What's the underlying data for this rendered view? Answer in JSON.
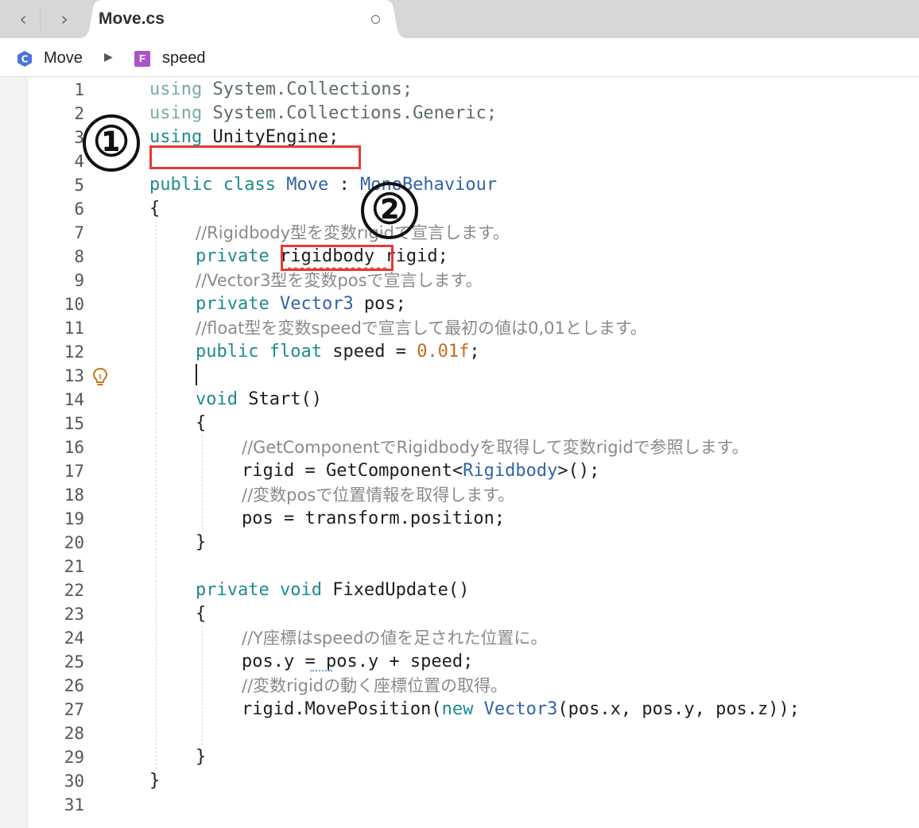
{
  "tab": {
    "title": "Move.cs",
    "back_icon": "chevron-left-icon",
    "forward_icon": "chevron-right-icon",
    "dirty_icon": "circle-icon"
  },
  "breadcrumb": {
    "class_badge": "C",
    "class_name": "Move",
    "field_badge": "F",
    "field_name": "speed"
  },
  "markers": {
    "one": "①",
    "two": "②"
  },
  "colors": {
    "keyword": "#1c8c8c",
    "type": "#3363a5",
    "number": "#c46a1c",
    "comment": "#8a8a8a",
    "annotation": "#e53935"
  },
  "editor": {
    "lines": [
      {
        "n": "1",
        "indent": 0,
        "tokens": [
          {
            "t": "using",
            "c": "kwl"
          },
          {
            "t": " System.Collections;",
            "c": "plain-light"
          }
        ]
      },
      {
        "n": "2",
        "indent": 0,
        "tokens": [
          {
            "t": "using",
            "c": "kwl"
          },
          {
            "t": " System.Collections.Generic;",
            "c": "plain-light"
          }
        ]
      },
      {
        "n": "3",
        "indent": 0,
        "tokens": [
          {
            "t": "using",
            "c": "kw"
          },
          {
            "t": " UnityEngine;",
            "c": "plain"
          }
        ]
      },
      {
        "n": "4",
        "indent": 0,
        "tokens": []
      },
      {
        "n": "5",
        "indent": 0,
        "tokens": [
          {
            "t": "public",
            "c": "kw"
          },
          {
            "t": " ",
            "c": "plain"
          },
          {
            "t": "class",
            "c": "kw"
          },
          {
            "t": " ",
            "c": "plain"
          },
          {
            "t": "Move",
            "c": "typ"
          },
          {
            "t": " : ",
            "c": "plain"
          },
          {
            "t": "MonoBehaviour",
            "c": "typ"
          }
        ]
      },
      {
        "n": "6",
        "indent": 0,
        "tokens": [
          {
            "t": "{",
            "c": "plain"
          }
        ]
      },
      {
        "n": "7",
        "indent": 1,
        "tokens": [
          {
            "t": "//Rigidbody型を変数rigidで宣言します。",
            "c": "cmt"
          }
        ]
      },
      {
        "n": "8",
        "indent": 1,
        "tokens": [
          {
            "t": "private",
            "c": "kw"
          },
          {
            "t": " rigidbody rigid;",
            "c": "plain"
          }
        ]
      },
      {
        "n": "9",
        "indent": 1,
        "tokens": [
          {
            "t": "//Vector3型を変数posで宣言します。",
            "c": "cmt"
          }
        ]
      },
      {
        "n": "10",
        "indent": 1,
        "tokens": [
          {
            "t": "private",
            "c": "kw"
          },
          {
            "t": " ",
            "c": "plain"
          },
          {
            "t": "Vector3",
            "c": "typ"
          },
          {
            "t": " pos;",
            "c": "plain"
          }
        ]
      },
      {
        "n": "11",
        "indent": 1,
        "tokens": [
          {
            "t": "//float型を変数speedで宣言して最初の値は0,01とします。",
            "c": "cmt"
          }
        ]
      },
      {
        "n": "12",
        "indent": 1,
        "tokens": [
          {
            "t": "public",
            "c": "kw"
          },
          {
            "t": " ",
            "c": "plain"
          },
          {
            "t": "float",
            "c": "kw"
          },
          {
            "t": " speed = ",
            "c": "plain"
          },
          {
            "t": "0.01f",
            "c": "num"
          },
          {
            "t": ";",
            "c": "plain"
          }
        ]
      },
      {
        "n": "13",
        "indent": 1,
        "tokens": []
      },
      {
        "n": "14",
        "indent": 1,
        "tokens": [
          {
            "t": "void",
            "c": "kw"
          },
          {
            "t": " Start()",
            "c": "plain"
          }
        ]
      },
      {
        "n": "15",
        "indent": 1,
        "tokens": [
          {
            "t": "{",
            "c": "plain"
          }
        ]
      },
      {
        "n": "16",
        "indent": 2,
        "tokens": [
          {
            "t": "//GetComponentでRigidbodyを取得して変数rigidで参照します。",
            "c": "cmt"
          }
        ]
      },
      {
        "n": "17",
        "indent": 2,
        "tokens": [
          {
            "t": "rigid = GetComponent<",
            "c": "plain"
          },
          {
            "t": "Rigidbody",
            "c": "typ"
          },
          {
            "t": ">();",
            "c": "plain"
          }
        ]
      },
      {
        "n": "18",
        "indent": 2,
        "tokens": [
          {
            "t": "//変数posで位置情報を取得します。",
            "c": "cmt"
          }
        ]
      },
      {
        "n": "19",
        "indent": 2,
        "tokens": [
          {
            "t": "pos = transform.position;",
            "c": "plain"
          }
        ]
      },
      {
        "n": "20",
        "indent": 1,
        "tokens": [
          {
            "t": "}",
            "c": "plain"
          }
        ]
      },
      {
        "n": "21",
        "indent": 0,
        "tokens": []
      },
      {
        "n": "22",
        "indent": 1,
        "tokens": [
          {
            "t": "private",
            "c": "kw"
          },
          {
            "t": " ",
            "c": "plain"
          },
          {
            "t": "void",
            "c": "kw"
          },
          {
            "t": " FixedUpdate()",
            "c": "plain"
          }
        ]
      },
      {
        "n": "23",
        "indent": 1,
        "tokens": [
          {
            "t": "{",
            "c": "plain"
          }
        ]
      },
      {
        "n": "24",
        "indent": 2,
        "tokens": [
          {
            "t": "//Y座標はspeedの値を足された位置に。",
            "c": "cmt"
          }
        ]
      },
      {
        "n": "25",
        "indent": 2,
        "tokens": [
          {
            "t": "pos.y = pos.y + speed;",
            "c": "plain"
          }
        ]
      },
      {
        "n": "26",
        "indent": 2,
        "tokens": [
          {
            "t": "//変数rigidの動く座標位置の取得。",
            "c": "cmt"
          }
        ]
      },
      {
        "n": "27",
        "indent": 2,
        "tokens": [
          {
            "t": "rigid.MovePosition(",
            "c": "plain"
          },
          {
            "t": "new",
            "c": "kw"
          },
          {
            "t": " ",
            "c": "plain"
          },
          {
            "t": "Vector3",
            "c": "typ"
          },
          {
            "t": "(pos.x, pos.y, pos.z));",
            "c": "plain"
          }
        ]
      },
      {
        "n": "28",
        "indent": 2,
        "tokens": []
      },
      {
        "n": "29",
        "indent": 1,
        "tokens": [
          {
            "t": "}",
            "c": "plain"
          }
        ]
      },
      {
        "n": "30",
        "indent": 0,
        "tokens": [
          {
            "t": "}",
            "c": "plain"
          }
        ]
      },
      {
        "n": "31",
        "indent": 0,
        "tokens": []
      }
    ]
  }
}
